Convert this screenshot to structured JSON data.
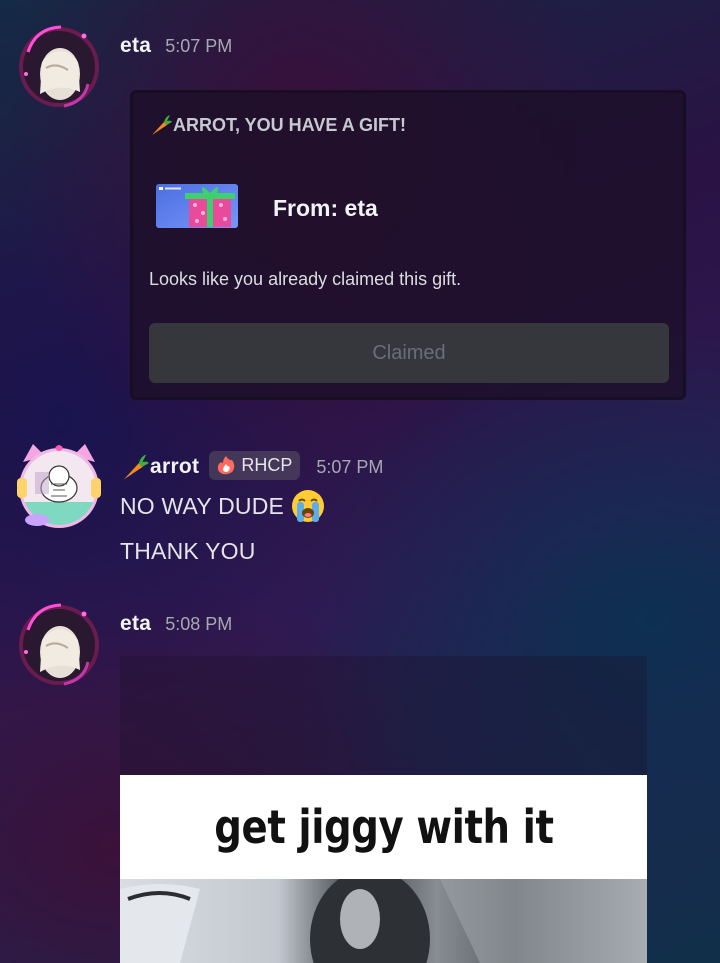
{
  "messages": [
    {
      "username": "eta",
      "time": "5:07 PM",
      "gift": {
        "title": "ARROT, YOU HAVE A GIFT!",
        "from": "From: eta",
        "note": "Looks like you already claimed this gift.",
        "button_label": "Claimed",
        "card_logo_text": "DISCORD"
      }
    },
    {
      "username": "arrot",
      "badge": "RHCP",
      "time": "5:07 PM",
      "lines": [
        "NO WAY DUDE",
        "THANK YOU"
      ],
      "emoji": "loudly-crying-face"
    },
    {
      "username": "eta",
      "time": "5:08 PM",
      "embed": {
        "caption": "get jiggy with it"
      }
    }
  ],
  "colors": {
    "username": "#f2f3f5",
    "timestamp": "#a6a9b2",
    "claimed_button": "#36363d",
    "claimed_text": "#6b6e76",
    "gift_box": "#e94a9a",
    "ribbon": "#3ecf6e"
  }
}
